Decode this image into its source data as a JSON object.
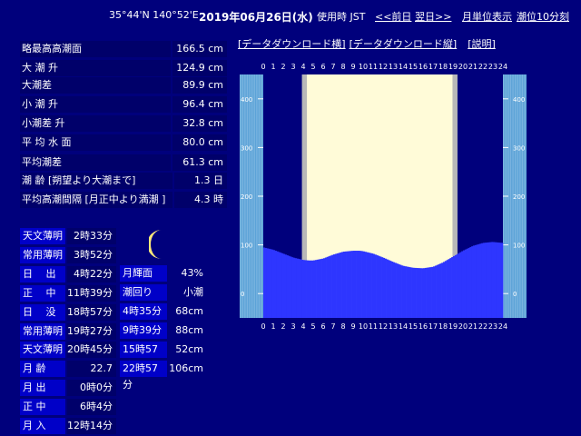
{
  "header": {
    "coords": "35°44'N 140°52'E",
    "date": "2019年06月26日(水)",
    "tz": "使用時 JST",
    "prev": "<<前日",
    "next": "翌日>>",
    "monthly": "月単位表示",
    "interval": "潮位10分刻"
  },
  "download": {
    "horizontal": "[データダウンロード横]",
    "vertical": "[データダウンロード縦]",
    "help": "[説明]"
  },
  "stats": [
    {
      "label": "略最高高潮面",
      "value": "166.5 cm"
    },
    {
      "label": "大 潮 升",
      "value": "124.9 cm"
    },
    {
      "label": "大潮差",
      "value": "89.9 cm"
    },
    {
      "label": "小 潮 升",
      "value": "96.4 cm"
    },
    {
      "label": "小潮差 升",
      "value": "32.8 cm"
    },
    {
      "label": "平 均 水 面",
      "value": "80.0 cm"
    },
    {
      "label": "平均潮差",
      "value": "61.3 cm"
    },
    {
      "label": "潮 齢 [朔望より大潮まで]",
      "value": "1.3 日"
    },
    {
      "label": "平均高潮間隔 [月正中より満潮 ]",
      "value": "4.3 時"
    }
  ],
  "sun_moon": [
    {
      "label": "天文薄明",
      "value": "2時33分"
    },
    {
      "label": "常用薄明",
      "value": "3時52分"
    },
    {
      "label": "日　 出",
      "value": "4時22分"
    },
    {
      "label": "正　 中",
      "value": "11時39分"
    },
    {
      "label": "日　 没",
      "value": "18時57分"
    },
    {
      "label": "常用薄明",
      "value": "19時27分"
    },
    {
      "label": "天文薄明",
      "value": "20時45分"
    },
    {
      "label": "月 齢",
      "value": "22.7"
    },
    {
      "label": "月 出",
      "value": "0時0分"
    },
    {
      "label": "正 中",
      "value": "6時4分"
    },
    {
      "label": "月 入",
      "value": "12時14分"
    }
  ],
  "moon": {
    "icon": "crescent-moon-icon",
    "age_label": "月輝面",
    "age_value": "43%",
    "tide_label": "潮回り",
    "tide_value": "小潮"
  },
  "tide_events": [
    {
      "time": "4時35分",
      "level": "68cm"
    },
    {
      "time": "9時39分",
      "level": "88cm"
    },
    {
      "time": "15時57分",
      "level": "52cm"
    },
    {
      "time": "22時57分",
      "level": "106cm"
    }
  ],
  "chart_data": {
    "type": "bar",
    "hours": [
      "0",
      "1",
      "2",
      "3",
      "4",
      "5",
      "6",
      "7",
      "8",
      "9",
      "10",
      "11",
      "12",
      "13",
      "14",
      "15",
      "16",
      "17",
      "18",
      "19",
      "20",
      "21",
      "22",
      "23",
      "24"
    ],
    "y_ticks": [
      "400",
      "300",
      "200",
      "100",
      "0"
    ],
    "ylim": [
      -50,
      450
    ],
    "daylight": [
      4.37,
      18.95
    ],
    "twilight": [
      3.87,
      19.45
    ],
    "tide_curve_cm": [
      [
        0,
        95
      ],
      [
        1,
        90
      ],
      [
        2,
        82
      ],
      [
        3,
        74
      ],
      [
        4,
        69
      ],
      [
        4.58,
        68
      ],
      [
        5,
        68
      ],
      [
        6,
        72
      ],
      [
        7,
        80
      ],
      [
        8,
        86
      ],
      [
        9,
        88
      ],
      [
        9.65,
        88
      ],
      [
        10,
        87
      ],
      [
        11,
        82
      ],
      [
        12,
        74
      ],
      [
        13,
        65
      ],
      [
        14,
        57
      ],
      [
        15,
        53
      ],
      [
        15.95,
        52
      ],
      [
        16,
        52
      ],
      [
        17,
        55
      ],
      [
        18,
        64
      ],
      [
        19,
        76
      ],
      [
        20,
        88
      ],
      [
        21,
        98
      ],
      [
        22,
        104
      ],
      [
        22.95,
        106
      ],
      [
        24,
        104
      ]
    ],
    "colors": {
      "bg": "#00007c",
      "daylight": "#fffbd8",
      "twilight": "#b8b8b8",
      "bars": "#2e36ff",
      "scale": "#5ca3d8",
      "axis_text": "#ffffff"
    }
  }
}
